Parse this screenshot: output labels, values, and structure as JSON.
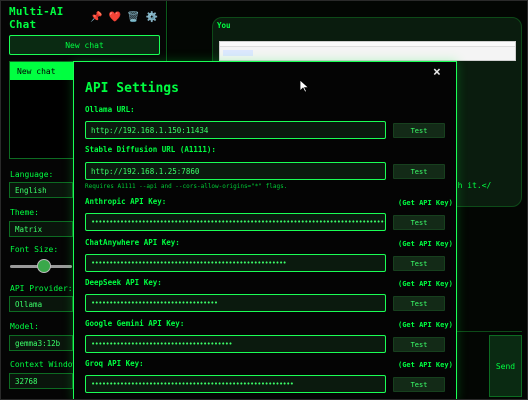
{
  "sidebar": {
    "app_title": "Multi-AI Chat",
    "header_icons": [
      "📌",
      "❤️",
      "🗑️",
      "⚙️"
    ],
    "new_chat_label": "New chat",
    "chats": [
      "New chat"
    ],
    "language_label": "Language:",
    "language_value": "English",
    "theme_label": "Theme:",
    "theme_value": "Matrix",
    "font_size_label": "Font Size:",
    "font_size_level": 0.55,
    "provider_label": "API Provider:",
    "provider_value": "Ollama",
    "model_label": "Model:",
    "model_value": "gemma3:12b",
    "context_label": "Context Window",
    "context_value": "32768"
  },
  "main": {
    "you_label": "You",
    "message_tail": "ith it.</",
    "send_label": "Send"
  },
  "modal": {
    "title": "API Settings",
    "close_symbol": "×",
    "ollama_label": "Ollama URL:",
    "ollama_value": "http://192.168.1.150:11434",
    "sd_label": "Stable Diffusion URL (A1111):",
    "sd_value": "http://192.168.1.25:7860",
    "sd_note": "Requires A1111 --api and --cors-allow-origins=\"*\" flags.",
    "test_label": "Test",
    "get_key_label": "(Get API Key)",
    "anthropic_label": "Anthropic API Key:",
    "anthropic_value": "••••••••••••••••••••••••••••••••••••••••••••••••••••••••••••••••••••••••••••••••••••",
    "chatanywhere_label": "ChatAnywhere API Key:",
    "chatanywhere_value": "••••••••••••••••••••••••••••••••••••••••••••••••••••••",
    "deepseek_label": "DeepSeek API Key:",
    "deepseek_value": "•••••••••••••••••••••••••••••••••••",
    "gemini_label": "Google Gemini API Key:",
    "gemini_value": "•••••••••••••••••••••••••••••••••••••••",
    "groq_label": "Groq API Key:",
    "groq_value": "••••••••••••••••••••••••••••••••••••••••••••••••••••••••"
  },
  "colors": {
    "accent": "#00ff41",
    "background": "#000000"
  }
}
